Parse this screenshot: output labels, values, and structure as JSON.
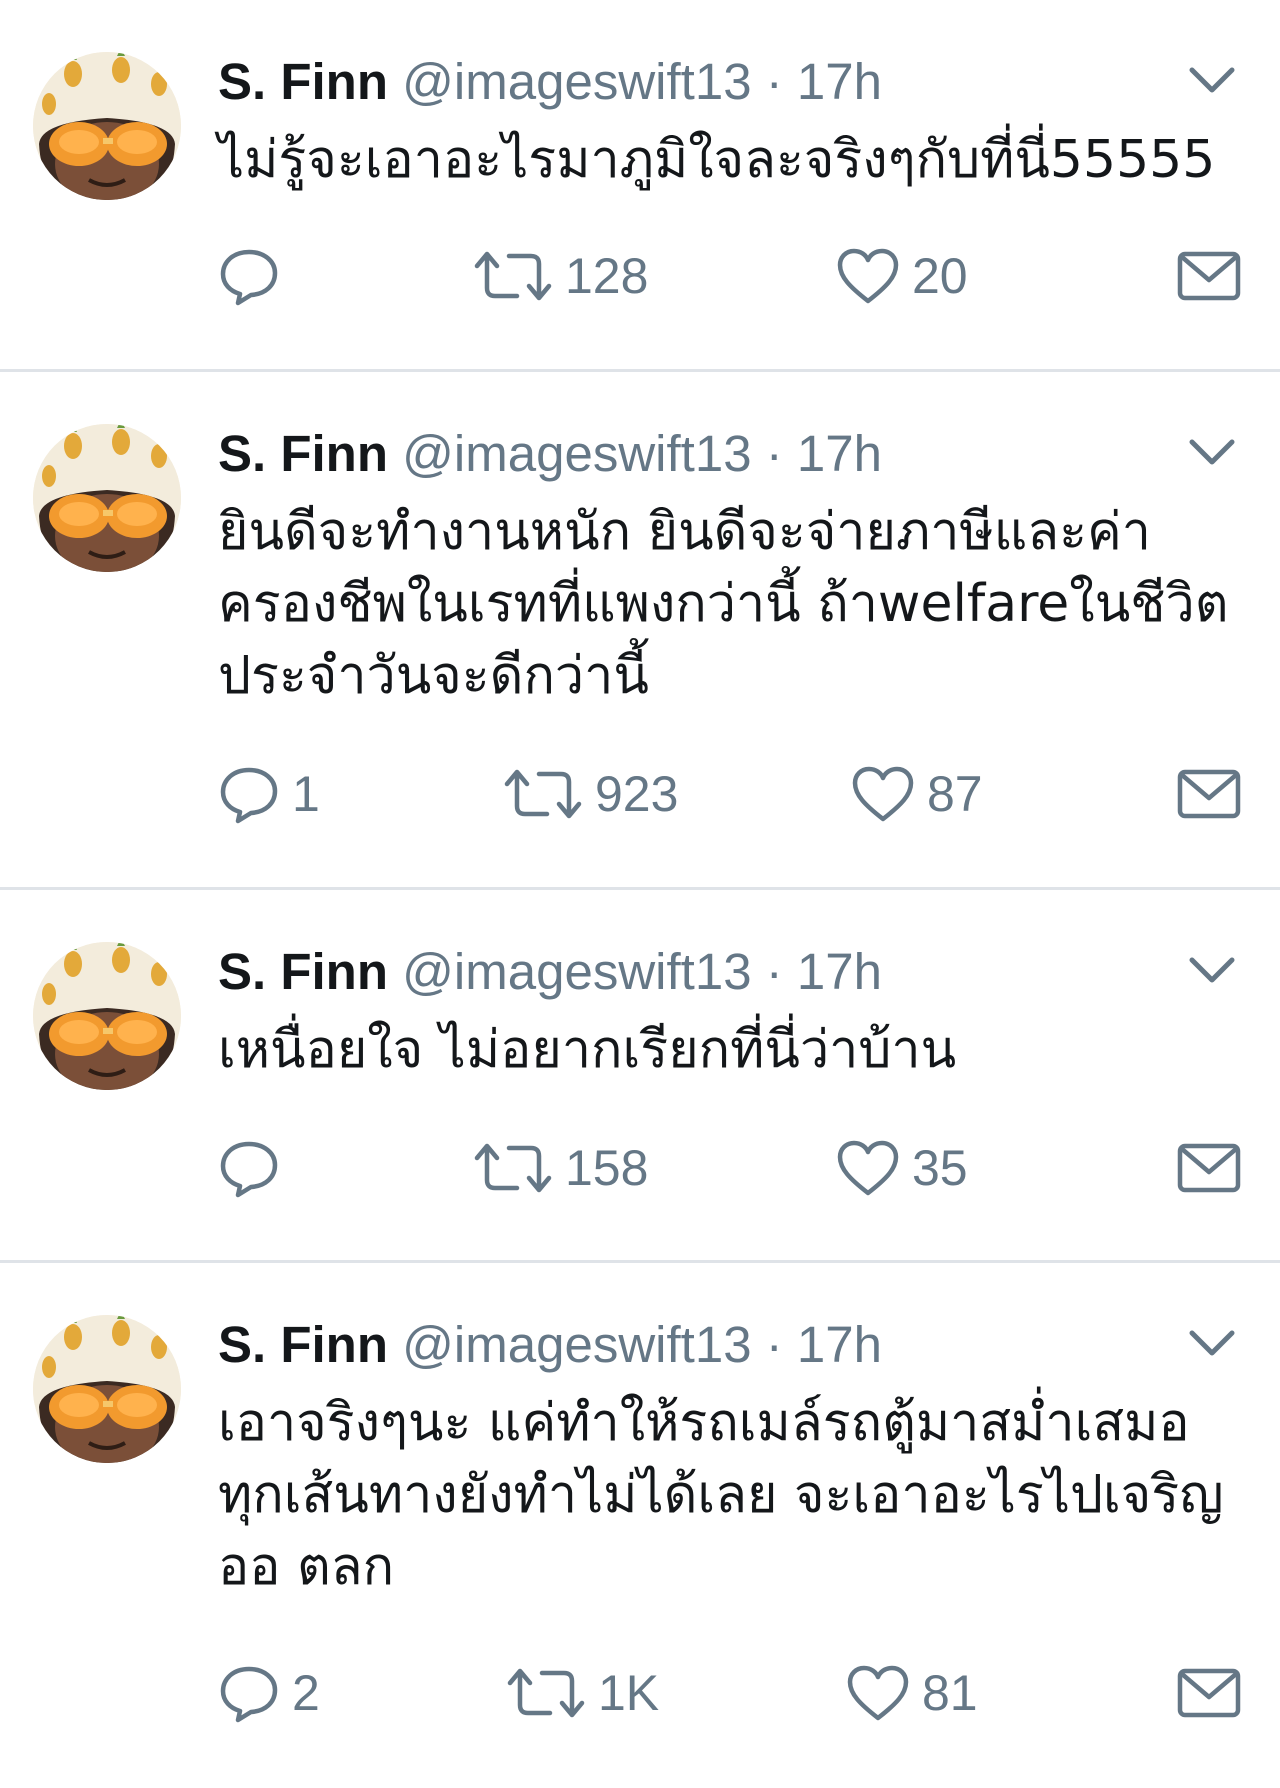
{
  "colors": {
    "text": "#14171a",
    "secondary": "#657786",
    "divider": "#dfe3e8",
    "background": "#ffffff"
  },
  "icons": {
    "reply": "reply-bubble-icon",
    "retweet": "retweet-arrows-icon",
    "like": "heart-icon",
    "dm": "envelope-icon",
    "caret": "chevron-down-icon"
  },
  "tweets": [
    {
      "name": "S. Finn",
      "handle": "@imageswift13",
      "separator": "·",
      "time": "17h",
      "text": "ไม่รู้จะเอาอะไรมาภูมิใจละจริงๆกับที่นี่55555",
      "replies": "",
      "retweets": "128",
      "likes": "20"
    },
    {
      "name": "S. Finn",
      "handle": "@imageswift13",
      "separator": "·",
      "time": "17h",
      "text": "ยินดีจะทำงานหนัก ยินดีจะจ่ายภาษีและค่าครองชีพในเรทที่แพงกว่านี้ ถ้าwelfareในชีวิตประจำวันจะดีกว่านี้",
      "replies": "1",
      "retweets": "923",
      "likes": "87"
    },
    {
      "name": "S. Finn",
      "handle": "@imageswift13",
      "separator": "·",
      "time": "17h",
      "text": "เหนื่อยใจ ไม่อยากเรียกที่นี่ว่าบ้าน",
      "replies": "",
      "retweets": "158",
      "likes": "35"
    },
    {
      "name": "S. Finn",
      "handle": "@imageswift13",
      "separator": "·",
      "time": "17h",
      "text": "เอาจริงๆนะ แค่ทำให้รถเมล์รถตู้มาสม่ำเสมอทุกเส้นทางยังทำไม่ได้เลย จะเอาอะไรไปเจริญ ออ ตลก",
      "replies": "2",
      "retweets": "1K",
      "likes": "81"
    }
  ]
}
